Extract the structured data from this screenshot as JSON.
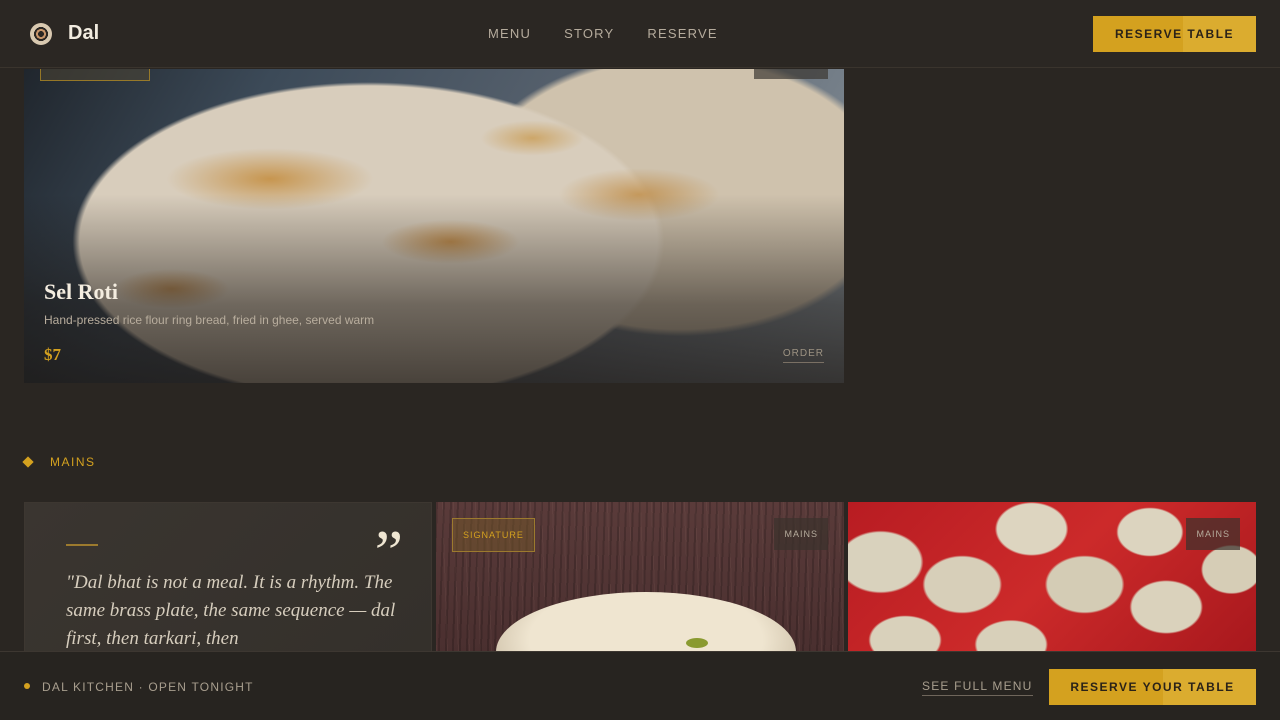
{
  "header": {
    "brand": "Dal",
    "nav": [
      "MENU",
      "STORY",
      "RESERVE"
    ],
    "cta": "RESERVE TABLE"
  },
  "featured": {
    "title": "Sel Roti",
    "description": "Hand-pressed rice flour ring bread, fried in ghee, served warm",
    "price": "$7",
    "action": "ORDER"
  },
  "section": {
    "label": "MAINS"
  },
  "quote": {
    "mark": "”",
    "text": "\"Dal bhat is not a meal. It is a rhythm. The same brass plate, the same sequence — dal first, then tarkari, then"
  },
  "dishes": [
    {
      "badge": "SIGNATURE",
      "category": "MAINS"
    },
    {
      "category": "MAINS"
    }
  ],
  "bottom_bar": {
    "status": "DAL KITCHEN · OPEN TONIGHT",
    "link": "SEE FULL MENU",
    "cta": "RESERVE YOUR TABLE"
  },
  "colors": {
    "accent": "#d4a11f",
    "background": "#2a2622"
  }
}
